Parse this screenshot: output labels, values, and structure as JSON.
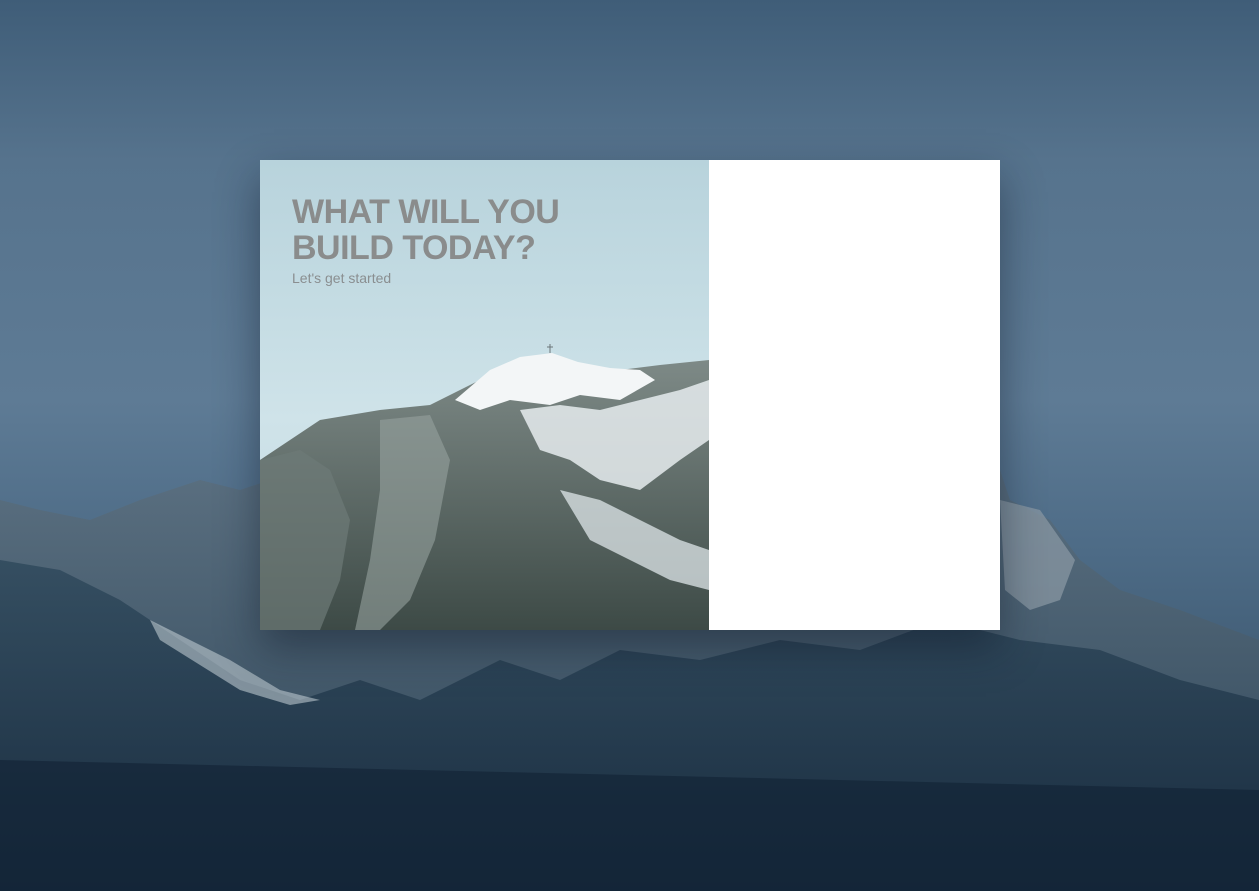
{
  "hero": {
    "headline_line1": "WHAT WILL YOU",
    "headline_line2": "BUILD TODAY?",
    "subheadline": "Let's get started"
  },
  "colors": {
    "background": "#56738d",
    "headline": "#8a8c8c",
    "panel": "#ffffff"
  }
}
